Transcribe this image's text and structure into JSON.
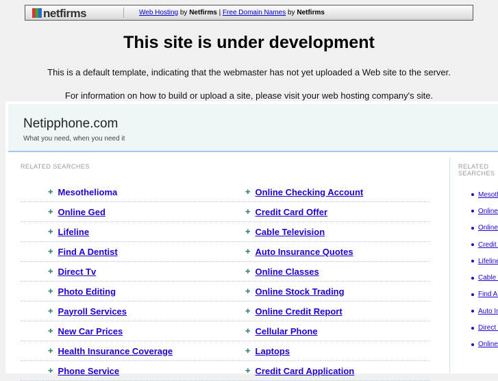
{
  "banner": {
    "logo": "netfirms",
    "link1": "Web Hosting",
    "by": "by",
    "brand": "Netfirms",
    "pipe": "|",
    "link2": "Free Domain Names"
  },
  "title": "This site is under development",
  "line1": "This is a default template, indicating that the webmaster has not yet uploaded a Web site to the server.",
  "line2": "For information on how to build or upload a site, please visit your web hosting company's site.",
  "site": {
    "name": "Netipphone.com",
    "tagline": "What you need, when you need it"
  },
  "related_label": "RELATED SEARCHES",
  "rows": [
    [
      "Mesothelioma",
      "Online Checking Account"
    ],
    [
      "Online Ged",
      "Credit Card Offer"
    ],
    [
      "Lifeline",
      "Cable Television"
    ],
    [
      "Find A Dentist",
      "Auto Insurance Quotes"
    ],
    [
      "Direct Tv",
      "Online Classes"
    ],
    [
      "Photo Editing",
      "Online Stock Trading"
    ],
    [
      "Payroll Services",
      "Online Credit Report"
    ],
    [
      "New Car Prices",
      "Cellular Phone"
    ],
    [
      "Health Insurance Coverage",
      "Laptops"
    ],
    [
      "Phone Service",
      "Credit Card Application"
    ]
  ],
  "side": [
    "Mesothelioma",
    "Online Ged",
    "Online Checking Account",
    "Credit Card Offer",
    "Lifeline",
    "Cable Television",
    "Find A Dentist",
    "Auto Insurance Quotes",
    "Direct Tv",
    "Online Classes"
  ]
}
